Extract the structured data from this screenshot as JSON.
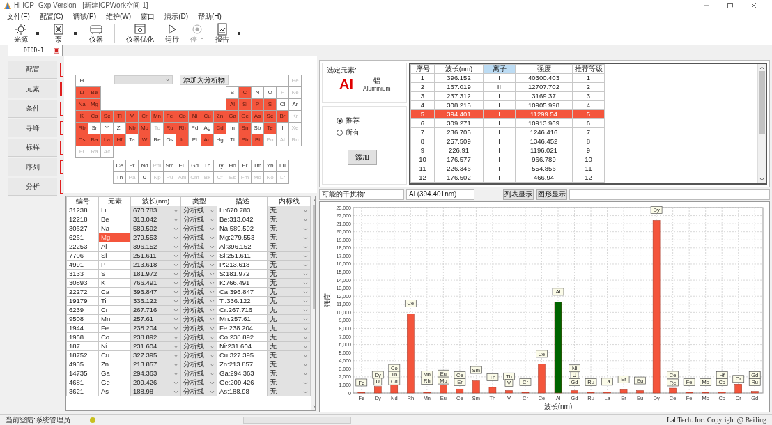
{
  "window": {
    "title": "Hi ICP- Gxp Version - [新建ICPWork空间-1]"
  },
  "menu": [
    "文件(F)",
    "配置(C)",
    "调试(P)",
    "维护(W)",
    "窗口",
    "演示(D)",
    "帮助(H)"
  ],
  "toolbar": [
    {
      "label": "光源",
      "dropdown": true,
      "disabled": false
    },
    {
      "label": "泵",
      "dropdown": true,
      "disabled": false
    },
    {
      "label": "仪器",
      "dropdown": false,
      "disabled": false
    },
    {
      "label": "仪器优化",
      "dropdown": false,
      "disabled": false
    },
    {
      "label": "运行",
      "dropdown": false,
      "disabled": false
    },
    {
      "label": "停止",
      "dropdown": false,
      "disabled": true
    },
    {
      "label": "报告",
      "dropdown": true,
      "disabled": false
    }
  ],
  "tabs": [
    {
      "label": "DIDD-1",
      "selected": true
    }
  ],
  "sidebar": {
    "items": [
      {
        "label": "配置",
        "selected": false
      },
      {
        "label": "元素",
        "selected": true
      },
      {
        "label": "条件",
        "selected": false
      },
      {
        "label": "寻峰",
        "selected": false
      },
      {
        "label": "标样",
        "selected": false
      },
      {
        "label": "序列",
        "selected": false
      },
      {
        "label": "分析",
        "selected": false
      }
    ]
  },
  "periodic_table": {
    "add_button": "添加为分析物",
    "rows": [
      [
        {
          "symbol": "H",
          "selected": false,
          "disabled": false
        },
        "",
        "",
        "",
        "",
        "",
        "",
        "",
        "",
        "",
        "",
        "",
        "",
        "",
        "",
        "",
        "",
        {
          "symbol": "He",
          "selected": false,
          "disabled": true
        }
      ],
      [
        {
          "symbol": "Li",
          "selected": true,
          "disabled": false
        },
        {
          "symbol": "Be",
          "selected": true,
          "disabled": false
        },
        "",
        "",
        "",
        "",
        "",
        "",
        "",
        "",
        "",
        "",
        {
          "symbol": "B",
          "selected": false,
          "disabled": false
        },
        {
          "symbol": "C",
          "selected": true,
          "disabled": false
        },
        {
          "symbol": "N",
          "selected": false,
          "disabled": false
        },
        {
          "symbol": "O",
          "selected": false,
          "disabled": false
        },
        {
          "symbol": "F",
          "selected": false,
          "disabled": true
        },
        {
          "symbol": "Ne",
          "selected": false,
          "disabled": true
        }
      ],
      [
        {
          "symbol": "Na",
          "selected": true,
          "disabled": false
        },
        {
          "symbol": "Mg",
          "selected": true,
          "disabled": false
        },
        "",
        "",
        "",
        "",
        "",
        "",
        "",
        "",
        "",
        "",
        {
          "symbol": "Al",
          "selected": true,
          "disabled": false
        },
        {
          "symbol": "Si",
          "selected": true,
          "disabled": false
        },
        {
          "symbol": "P",
          "selected": true,
          "disabled": false
        },
        {
          "symbol": "S",
          "selected": true,
          "disabled": false
        },
        {
          "symbol": "Cl",
          "selected": false,
          "disabled": false
        },
        {
          "symbol": "Ar",
          "selected": false,
          "disabled": false
        }
      ],
      [
        {
          "symbol": "K",
          "selected": true,
          "disabled": false
        },
        {
          "symbol": "Ca",
          "selected": true,
          "disabled": false
        },
        {
          "symbol": "Sc",
          "selected": true,
          "disabled": false
        },
        {
          "symbol": "Ti",
          "selected": true,
          "disabled": false
        },
        {
          "symbol": "V",
          "selected": true,
          "disabled": false
        },
        {
          "symbol": "Cr",
          "selected": true,
          "disabled": false
        },
        {
          "symbol": "Mn",
          "selected": true,
          "disabled": false
        },
        {
          "symbol": "Fe",
          "selected": true,
          "disabled": false
        },
        {
          "symbol": "Co",
          "selected": true,
          "disabled": false
        },
        {
          "symbol": "Ni",
          "selected": true,
          "disabled": false
        },
        {
          "symbol": "Cu",
          "selected": true,
          "disabled": false
        },
        {
          "symbol": "Zn",
          "selected": true,
          "disabled": false
        },
        {
          "symbol": "Ga",
          "selected": true,
          "disabled": false
        },
        {
          "symbol": "Ge",
          "selected": true,
          "disabled": false
        },
        {
          "symbol": "As",
          "selected": true,
          "disabled": false
        },
        {
          "symbol": "Se",
          "selected": true,
          "disabled": false
        },
        {
          "symbol": "Br",
          "selected": true,
          "disabled": false
        },
        {
          "symbol": "Kr",
          "selected": false,
          "disabled": true
        }
      ],
      [
        {
          "symbol": "Rb",
          "selected": true,
          "disabled": false
        },
        {
          "symbol": "Sr",
          "selected": false,
          "disabled": false
        },
        {
          "symbol": "Y",
          "selected": false,
          "disabled": false
        },
        {
          "symbol": "Zr",
          "selected": false,
          "disabled": false
        },
        {
          "symbol": "Nb",
          "selected": true,
          "disabled": false
        },
        {
          "symbol": "Mo",
          "selected": true,
          "disabled": false
        },
        {
          "symbol": "Tc",
          "selected": false,
          "disabled": true
        },
        {
          "symbol": "Ru",
          "selected": true,
          "disabled": false
        },
        {
          "symbol": "Rh",
          "selected": true,
          "disabled": false
        },
        {
          "symbol": "Pd",
          "selected": false,
          "disabled": false
        },
        {
          "symbol": "Ag",
          "selected": false,
          "disabled": false
        },
        {
          "symbol": "Cd",
          "selected": true,
          "disabled": false
        },
        {
          "symbol": "In",
          "selected": false,
          "disabled": false
        },
        {
          "symbol": "Sn",
          "selected": true,
          "disabled": false
        },
        {
          "symbol": "Sb",
          "selected": false,
          "disabled": false
        },
        {
          "symbol": "Te",
          "selected": true,
          "disabled": false
        },
        {
          "symbol": "I",
          "selected": false,
          "disabled": false
        },
        {
          "symbol": "Xe",
          "selected": false,
          "disabled": true
        }
      ],
      [
        {
          "symbol": "Cs",
          "selected": true,
          "disabled": false
        },
        {
          "symbol": "Ba",
          "selected": true,
          "disabled": false
        },
        {
          "symbol": "La",
          "selected": true,
          "disabled": false
        },
        {
          "symbol": "Hf",
          "selected": true,
          "disabled": false
        },
        {
          "symbol": "Ta",
          "selected": false,
          "disabled": false
        },
        {
          "symbol": "W",
          "selected": true,
          "disabled": false
        },
        {
          "symbol": "Re",
          "selected": false,
          "disabled": false
        },
        {
          "symbol": "Os",
          "selected": false,
          "disabled": false
        },
        {
          "symbol": "Ir",
          "selected": true,
          "disabled": false
        },
        {
          "symbol": "Pt",
          "selected": false,
          "disabled": false
        },
        {
          "symbol": "Au",
          "selected": true,
          "disabled": false
        },
        {
          "symbol": "Hg",
          "selected": false,
          "disabled": false
        },
        {
          "symbol": "Tl",
          "selected": false,
          "disabled": false
        },
        {
          "symbol": "Pb",
          "selected": true,
          "disabled": false
        },
        {
          "symbol": "Bi",
          "selected": true,
          "disabled": false
        },
        {
          "symbol": "Po",
          "selected": false,
          "disabled": true
        },
        {
          "symbol": "At",
          "selected": false,
          "disabled": true
        },
        {
          "symbol": "Rn",
          "selected": false,
          "disabled": true
        }
      ],
      [
        {
          "symbol": "Fr",
          "selected": false,
          "disabled": true
        },
        {
          "symbol": "Ra",
          "selected": false,
          "disabled": true
        },
        {
          "symbol": "Ac",
          "selected": false,
          "disabled": true
        }
      ]
    ],
    "f_block": [
      [
        {
          "symbol": "Ce",
          "selected": false,
          "disabled": false
        },
        {
          "symbol": "Pr",
          "selected": false,
          "disabled": false
        },
        {
          "symbol": "Nd",
          "selected": false,
          "disabled": false
        },
        {
          "symbol": "Pm",
          "selected": false,
          "disabled": true
        },
        {
          "symbol": "Sm",
          "selected": false,
          "disabled": false
        },
        {
          "symbol": "Eu",
          "selected": false,
          "disabled": false
        },
        {
          "symbol": "Gd",
          "selected": false,
          "disabled": false
        },
        {
          "symbol": "Tb",
          "selected": false,
          "disabled": false
        },
        {
          "symbol": "Dy",
          "selected": false,
          "disabled": false
        },
        {
          "symbol": "Ho",
          "selected": false,
          "disabled": false
        },
        {
          "symbol": "Er",
          "selected": false,
          "disabled": false
        },
        {
          "symbol": "Tm",
          "selected": false,
          "disabled": false
        },
        {
          "symbol": "Yb",
          "selected": false,
          "disabled": false
        },
        {
          "symbol": "Lu",
          "selected": false,
          "disabled": false
        }
      ],
      [
        {
          "symbol": "Th",
          "selected": false,
          "disabled": false
        },
        {
          "symbol": "Pa",
          "selected": false,
          "disabled": true
        },
        {
          "symbol": "U",
          "selected": false,
          "disabled": false
        },
        {
          "symbol": "Np",
          "selected": false,
          "disabled": true
        },
        {
          "symbol": "Pu",
          "selected": false,
          "disabled": true
        },
        {
          "symbol": "Am",
          "selected": false,
          "disabled": true
        },
        {
          "symbol": "Cm",
          "selected": false,
          "disabled": true
        },
        {
          "symbol": "Bk",
          "selected": false,
          "disabled": true
        },
        {
          "symbol": "Cf",
          "selected": false,
          "disabled": true
        },
        {
          "symbol": "Es",
          "selected": false,
          "disabled": true
        },
        {
          "symbol": "Fm",
          "selected": false,
          "disabled": true
        },
        {
          "symbol": "Md",
          "selected": false,
          "disabled": true
        },
        {
          "symbol": "No",
          "selected": false,
          "disabled": true
        },
        {
          "symbol": "Lr",
          "selected": false,
          "disabled": true
        }
      ]
    ]
  },
  "analysis_lines": {
    "columns": [
      {
        "label": "编号",
        "kind": "text"
      },
      {
        "label": "元素",
        "kind": "element"
      },
      {
        "label": "波长(nm)",
        "kind": "dropdown"
      },
      {
        "label": "类型",
        "kind": "dropdown"
      },
      {
        "label": "描述",
        "kind": "text"
      },
      {
        "label": "内标线",
        "kind": "dropdown"
      }
    ],
    "rows": [
      {
        "cells": [
          "31238",
          "Li",
          "670.783",
          "分析线",
          "Li:670.783",
          "无"
        ],
        "selected": false
      },
      {
        "cells": [
          "12218",
          "Be",
          "313.042",
          "分析线",
          "Be:313.042",
          "无"
        ],
        "selected": false
      },
      {
        "cells": [
          "30627",
          "Na",
          "589.592",
          "分析线",
          "Na:589.592",
          "无"
        ],
        "selected": false
      },
      {
        "cells": [
          "6261",
          "Mg",
          "279.553",
          "分析线",
          "Mg:279.553",
          "无"
        ],
        "selected": true
      },
      {
        "cells": [
          "22253",
          "Al",
          "396.152",
          "分析线",
          "Al:396.152",
          "无"
        ],
        "selected": false
      },
      {
        "cells": [
          "7706",
          "Si",
          "251.611",
          "分析线",
          "Si:251.611",
          "无"
        ],
        "selected": false
      },
      {
        "cells": [
          "4991",
          "P",
          "213.618",
          "分析线",
          "P:213.618",
          "无"
        ],
        "selected": false
      },
      {
        "cells": [
          "3133",
          "S",
          "181.972",
          "分析线",
          "S:181.972",
          "无"
        ],
        "selected": false
      },
      {
        "cells": [
          "30893",
          "K",
          "766.491",
          "分析线",
          "K:766.491",
          "无"
        ],
        "selected": false
      },
      {
        "cells": [
          "22272",
          "Ca",
          "396.847",
          "分析线",
          "Ca:396.847",
          "无"
        ],
        "selected": false
      },
      {
        "cells": [
          "19179",
          "Ti",
          "336.122",
          "分析线",
          "Ti:336.122",
          "无"
        ],
        "selected": false
      },
      {
        "cells": [
          "6239",
          "Cr",
          "267.716",
          "分析线",
          "Cr:267.716",
          "无"
        ],
        "selected": false
      },
      {
        "cells": [
          "9508",
          "Mn",
          "257.61",
          "分析线",
          "Mn:257.61",
          "无"
        ],
        "selected": false
      },
      {
        "cells": [
          "1944",
          "Fe",
          "238.204",
          "分析线",
          "Fe:238.204",
          "无"
        ],
        "selected": false
      },
      {
        "cells": [
          "1968",
          "Co",
          "238.892",
          "分析线",
          "Co:238.892",
          "无"
        ],
        "selected": false
      },
      {
        "cells": [
          "187",
          "Ni",
          "231.604",
          "分析线",
          "Ni:231.604",
          "无"
        ],
        "selected": false
      },
      {
        "cells": [
          "18752",
          "Cu",
          "327.395",
          "分析线",
          "Cu:327.395",
          "无"
        ],
        "selected": false
      },
      {
        "cells": [
          "4935",
          "Zn",
          "213.857",
          "分析线",
          "Zn:213.857",
          "无"
        ],
        "selected": false
      },
      {
        "cells": [
          "14735",
          "Ga",
          "294.363",
          "分析线",
          "Ga:294.363",
          "无"
        ],
        "selected": false
      },
      {
        "cells": [
          "4681",
          "Ge",
          "209.426",
          "分析线",
          "Ge:209.426",
          "无"
        ],
        "selected": false
      },
      {
        "cells": [
          "3621",
          "As",
          "188.98",
          "分析线",
          "As:188.98",
          "无"
        ],
        "selected": false
      }
    ]
  },
  "selected_element": {
    "label": "选定元素:",
    "symbol": "Al",
    "name_zh": "铝",
    "name": "Aluminium"
  },
  "line_filter": {
    "options": [
      {
        "label": "推荐",
        "selected": true
      },
      {
        "label": "所有",
        "selected": false
      }
    ],
    "add_button": "添加"
  },
  "spectral_lines": {
    "columns": [
      {
        "label": "序号",
        "highlighted": false
      },
      {
        "label": "波长(nm)",
        "highlighted": false
      },
      {
        "label": "离子",
        "highlighted": true
      },
      {
        "label": "强度",
        "highlighted": false
      },
      {
        "label": "推荐等级",
        "highlighted": false
      }
    ],
    "rows": [
      {
        "cells": [
          "1",
          "396.152",
          "I",
          "40300.403",
          "1"
        ],
        "selected": false
      },
      {
        "cells": [
          "2",
          "167.019",
          "II",
          "12707.702",
          "2"
        ],
        "selected": false
      },
      {
        "cells": [
          "3",
          "237.312",
          "I",
          "3169.37",
          "3"
        ],
        "selected": false
      },
      {
        "cells": [
          "4",
          "308.215",
          "I",
          "10905.998",
          "4"
        ],
        "selected": false
      },
      {
        "cells": [
          "5",
          "394.401",
          "I",
          "11299.54",
          "5"
        ],
        "selected": true
      },
      {
        "cells": [
          "6",
          "309.271",
          "I",
          "10913.969",
          "6"
        ],
        "selected": false
      },
      {
        "cells": [
          "7",
          "236.705",
          "I",
          "1246.416",
          "7"
        ],
        "selected": false
      },
      {
        "cells": [
          "8",
          "257.509",
          "I",
          "1346.452",
          "8"
        ],
        "selected": false
      },
      {
        "cells": [
          "9",
          "226.91",
          "I",
          "1196.021",
          "9"
        ],
        "selected": false
      },
      {
        "cells": [
          "10",
          "176.577",
          "I",
          "966.789",
          "10"
        ],
        "selected": false
      },
      {
        "cells": [
          "11",
          "226.346",
          "I",
          "554.856",
          "11"
        ],
        "selected": false
      },
      {
        "cells": [
          "12",
          "176.502",
          "I",
          "466.94",
          "12"
        ],
        "selected": false
      }
    ]
  },
  "interference": {
    "label": "可能的干扰物:",
    "value": "Al (394.401nm)",
    "buttons": [
      "列表显示",
      "图形显示"
    ]
  },
  "chart": {
    "chart_data": {
      "type": "bar",
      "xlabel": "波长(nm)",
      "ylabel": "强度",
      "grid": true,
      "categories": [
        "Fe",
        "Dy",
        "Nd",
        "Rh",
        "Mn",
        "Eu",
        "Ce",
        "Sm",
        "Th",
        "V",
        "Cr",
        "Ce",
        "Al",
        "Gd",
        "Ru",
        "La",
        "Er",
        "Eu",
        "Dy",
        "Ce",
        "Fe",
        "Mo",
        "Co",
        "Cr",
        "Gd"
      ],
      "series": [
        {
          "color": "#f4553c",
          "values": [
            0,
            800,
            1000,
            9800,
            0,
            1000,
            500,
            1500,
            700,
            300,
            0,
            3600,
            null,
            300,
            0,
            100,
            400,
            300,
            21400,
            600,
            0,
            0,
            100,
            1100,
            200
          ]
        },
        {
          "color": "#006400",
          "values": [
            null,
            null,
            null,
            null,
            null,
            null,
            null,
            null,
            null,
            null,
            null,
            null,
            11300,
            null,
            null,
            null,
            null,
            null,
            null,
            null,
            null,
            null,
            null,
            null,
            null
          ]
        }
      ],
      "ylim": [
        0,
        23000
      ],
      "yticks": [
        {
          "value": 0,
          "label": "0"
        },
        {
          "value": 1000,
          "label": "1,000"
        },
        {
          "value": 2000,
          "label": "2,000"
        },
        {
          "value": 3000,
          "label": "3,000"
        },
        {
          "value": 4000,
          "label": "4,000"
        },
        {
          "value": 5000,
          "label": "5,000"
        },
        {
          "value": 6000,
          "label": "6,000"
        },
        {
          "value": 7000,
          "label": "7,000"
        },
        {
          "value": 8000,
          "label": "8,000"
        },
        {
          "value": 9000,
          "label": "9,000"
        },
        {
          "value": 10000,
          "label": "10,000"
        },
        {
          "value": 11000,
          "label": "11,000"
        },
        {
          "value": 12000,
          "label": "12,000"
        },
        {
          "value": 13000,
          "label": "13,000"
        },
        {
          "value": 14000,
          "label": "14,000"
        },
        {
          "value": 15000,
          "label": "15,000"
        },
        {
          "value": 16000,
          "label": "16,000"
        },
        {
          "value": 17000,
          "label": "17,000"
        },
        {
          "value": 18000,
          "label": "18,000"
        },
        {
          "value": 19000,
          "label": "19,000"
        },
        {
          "value": 20000,
          "label": "20,000"
        },
        {
          "value": 21000,
          "label": "21,000"
        },
        {
          "value": 22000,
          "label": "22,000"
        },
        {
          "value": 23000,
          "label": "23,000"
        }
      ],
      "annotations": [
        {
          "text": "Fe",
          "x": "Fe",
          "y": 1300
        },
        {
          "text": "Dy",
          "x": "Dy",
          "y": 2250
        },
        {
          "text": "U",
          "x": "Dy",
          "y": 1400
        },
        {
          "text": "Th",
          "x": "Nd",
          "y": 2300
        },
        {
          "text": "Cd",
          "x": "Nd",
          "y": 1450
        },
        {
          "text": "Co",
          "x": "Nd",
          "y": 3100
        },
        {
          "text": "Ce",
          "x": "Rh",
          "y": 11100
        },
        {
          "text": "Rh",
          "x": "Mn",
          "y": 1500
        },
        {
          "text": "Mn",
          "x": "Mn",
          "y": 2300
        },
        {
          "text": "Eu",
          "x": "Eu",
          "y": 2400
        },
        {
          "text": "Mo",
          "x": "Eu",
          "y": 1550
        },
        {
          "text": "Ce",
          "x": "Ce",
          "y": 2200
        },
        {
          "text": "Er",
          "x": "Ce",
          "y": 1350
        },
        {
          "text": "Sm",
          "x": "Sm",
          "y": 2850
        },
        {
          "text": "Th",
          "x": "Th",
          "y": 1950
        },
        {
          "text": "Th",
          "x": "V",
          "y": 2050
        },
        {
          "text": "V",
          "x": "V",
          "y": 1250
        },
        {
          "text": "Cr",
          "x": "Cr",
          "y": 1350
        },
        {
          "text": "Ce",
          "y": 4850
        },
        {
          "text": "Al",
          "x": "Al",
          "y": 12550
        },
        {
          "text": "U",
          "x": "Gd",
          "y": 2200
        },
        {
          "text": "Gd",
          "x": "Gd",
          "y": 1350
        },
        {
          "text": "Ni",
          "x": "Gd",
          "y": 3050
        },
        {
          "text": "Ru",
          "x": "Ru",
          "y": 1350
        },
        {
          "text": "La",
          "x": "La",
          "y": 1400
        },
        {
          "text": "Er",
          "x": "Er",
          "y": 1700
        },
        {
          "text": "Eu",
          "y": 1550
        },
        {
          "text": "Dy",
          "y": 22700
        },
        {
          "text": "Ce",
          "y": 2250
        },
        {
          "text": "Re",
          "y": 1300
        },
        {
          "text": "Fe",
          "y": 1350
        },
        {
          "text": "Mo",
          "x": "Mo",
          "y": 1350
        },
        {
          "text": "Hf",
          "x": "Co",
          "y": 2200
        },
        {
          "text": "Co",
          "x": "Co",
          "y": 1350
        },
        {
          "text": "Cr",
          "y": 1750
        },
        {
          "text": "Gd",
          "y": 2200
        },
        {
          "text": "Ru",
          "y": 1350
        }
      ]
    }
  },
  "status_bar": {
    "user": "当前登陆:系统管理员",
    "progress": {
      "level": 0
    },
    "copyright": "LabTech. Inc. Copyright @ BeiJing"
  }
}
